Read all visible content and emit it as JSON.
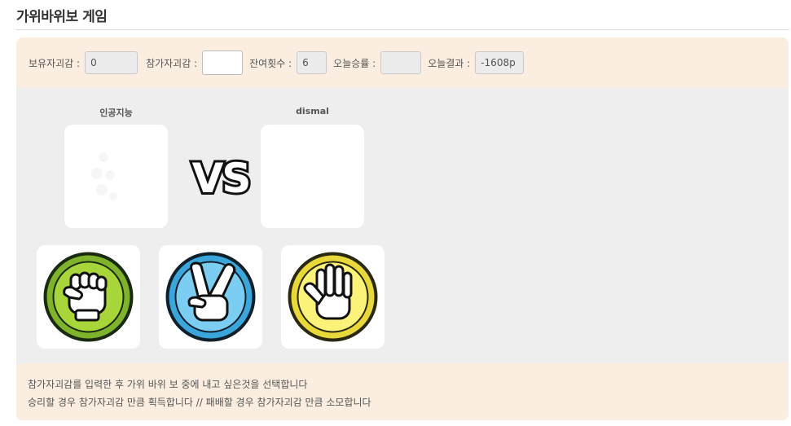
{
  "page": {
    "title": "가위바위보 게임"
  },
  "stats": {
    "owned_label": "보유자괴감 :",
    "owned_value": "0",
    "bet_label": "참가자괴감 :",
    "bet_value": "",
    "remaining_label": "잔여횟수 :",
    "remaining_value": "6",
    "winrate_label": "오늘승률 :",
    "winrate_value": "",
    "result_label": "오늘결과 :",
    "result_value": "-1608p"
  },
  "players": {
    "ai_name": "인공지능",
    "user_name": "dismal",
    "vs_text": "VS"
  },
  "choices": [
    {
      "name": "rock",
      "color": "#9ccc3c"
    },
    {
      "name": "scissors",
      "color": "#5bbbe8"
    },
    {
      "name": "paper",
      "color": "#f5e84a"
    }
  ],
  "instructions": {
    "line1": "참가자괴감를 입력한 후 가위 바위 보 중에 내고 싶은것을 선택합니다",
    "line2": "승리할 경우 참가자괴감 만큼 획득합니다 // 패배할 경우 참가자괴감 만큼 소모합니다"
  }
}
